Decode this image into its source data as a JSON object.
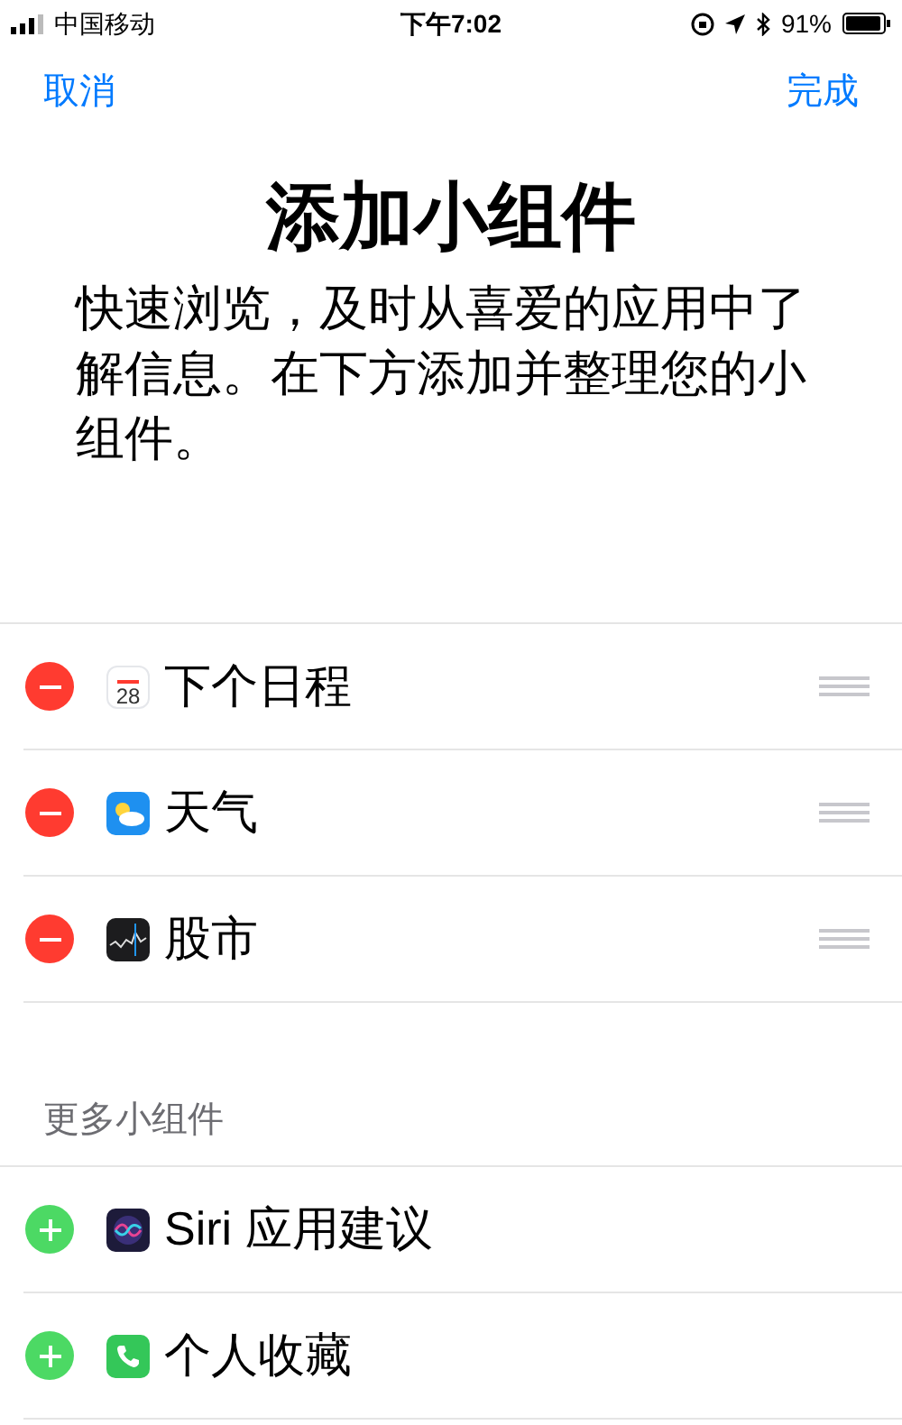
{
  "status_bar": {
    "carrier": "中国移动",
    "time": "下午7:02",
    "battery": "91%"
  },
  "nav": {
    "cancel": "取消",
    "done": "完成"
  },
  "header": {
    "title": "添加小组件",
    "description": "快速浏览，及时从喜爱的应用中了解信息。在下方添加并整理您的小组件。"
  },
  "sections": [
    {
      "kind": "remove",
      "reorderable": true,
      "items": [
        {
          "kind": "calendar",
          "label": "下个日程",
          "icon_text": "28"
        },
        {
          "kind": "weather",
          "label": "天气"
        },
        {
          "kind": "stocks",
          "label": "股市"
        }
      ]
    },
    {
      "title": "更多小组件",
      "kind": "add",
      "reorderable": false,
      "items": [
        {
          "kind": "siri",
          "label": "Siri 应用建议"
        },
        {
          "kind": "phone",
          "label": "个人收藏"
        }
      ]
    }
  ]
}
